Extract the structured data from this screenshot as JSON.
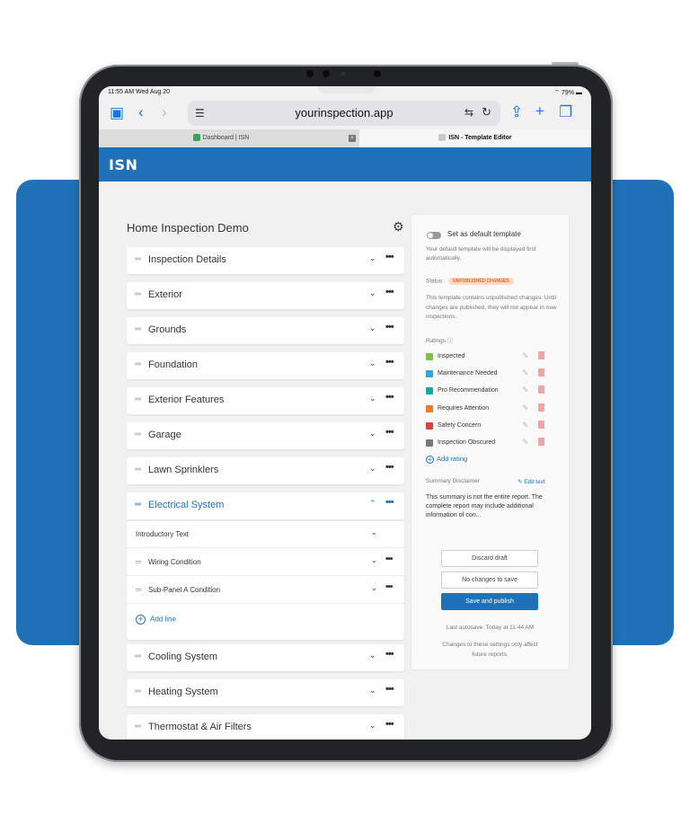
{
  "statusbar": {
    "time": "11:55 AM  Wed Aug 20",
    "battery": "79%"
  },
  "browser": {
    "url": "yourinspection.app",
    "tabs": [
      {
        "label": "Dashboard | ISN"
      },
      {
        "label": "ISN - Template Editor"
      }
    ]
  },
  "app": {
    "logo": "ISN"
  },
  "template": {
    "title": "Home Inspection Demo",
    "sections": [
      {
        "label": "Inspection Details"
      },
      {
        "label": "Exterior"
      },
      {
        "label": "Grounds"
      },
      {
        "label": "Foundation"
      },
      {
        "label": "Exterior Features"
      },
      {
        "label": "Garage"
      },
      {
        "label": "Lawn Sprinklers"
      },
      {
        "label": "Electrical System"
      },
      {
        "label": "Cooling System"
      },
      {
        "label": "Heating System"
      },
      {
        "label": "Thermostat & Air Filters"
      }
    ],
    "expanded": {
      "intro": "Introductory Text",
      "lines": [
        "Wiring Condition",
        "Sub-Panel A Condition"
      ],
      "add_line": "Add line"
    }
  },
  "panel": {
    "default_label": "Set as default template",
    "default_note": "Your default template will be displayed first automatically.",
    "status_label": "Status:",
    "status_badge": "UNPUBLISHED CHANGES",
    "status_desc": "This template contains unpublished changes. Until changes are published, they will not appear in new inspections.",
    "ratings_label": "Ratings",
    "ratings": [
      {
        "label": "Inspected",
        "color": "#7cc242"
      },
      {
        "label": "Maintenance Needed",
        "color": "#2aa9e0"
      },
      {
        "label": "Pro Recommendation",
        "color": "#1aa6b0"
      },
      {
        "label": "Requires Attention",
        "color": "#f07a22"
      },
      {
        "label": "Safety Concern",
        "color": "#e0403a"
      },
      {
        "label": "Inspection Obscured",
        "color": "#777777"
      }
    ],
    "add_rating": "Add rating",
    "disclaimer_label": "Summary Disclaimer",
    "edit_text": "Edit text",
    "summary": "This summary is not the entire report. The complete report may include additional information of con...",
    "discard_label": "Discard draft",
    "nochanges_label": "No changes to save",
    "publish_label": "Save and publish",
    "autosave": "Last autosave: Today at 11:44 AM",
    "changes_note": "Changes to these settings only affect future reports."
  },
  "colors": {
    "brand": "#1f72b8",
    "badge_bg": "#ffd9c2",
    "badge_text": "#e06a2a"
  }
}
